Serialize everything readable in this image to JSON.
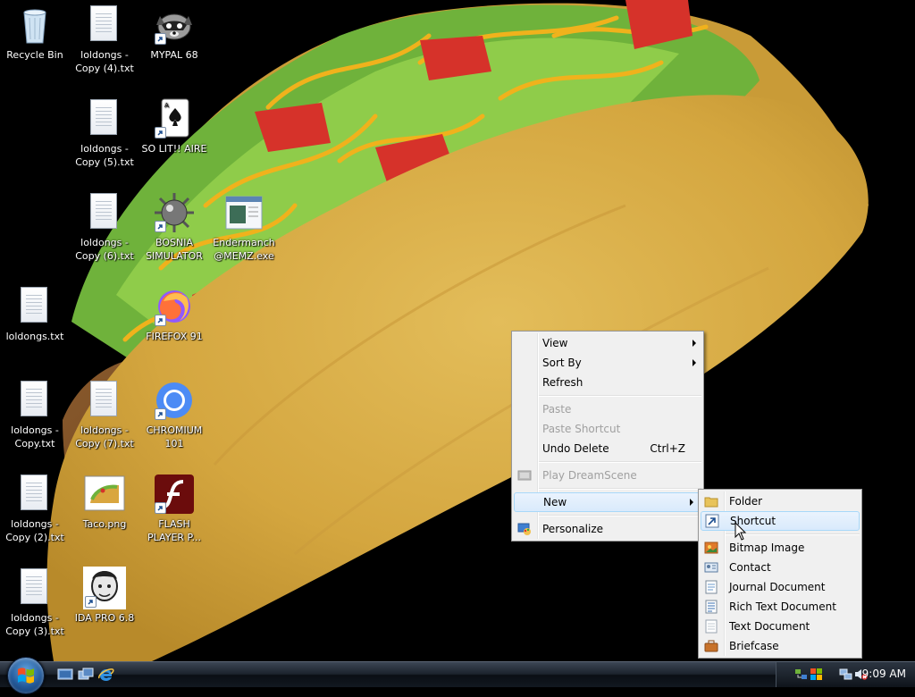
{
  "desktop": {
    "icons": [
      {
        "label": "Recycle Bin"
      },
      {
        "label": "loldongs - Copy (4).txt"
      },
      {
        "label": "MYPAL 68"
      },
      {
        "label": "loldongs - Copy (5).txt"
      },
      {
        "label": "SO LIT!! AIRE"
      },
      {
        "label": "loldongs - Copy (6).txt"
      },
      {
        "label": "BOSNIA SIMULATOR"
      },
      {
        "label": "Endermanch @MEMZ.exe"
      },
      {
        "label": "loldongs.txt"
      },
      {
        "label": "FIREFOX 91"
      },
      {
        "label": "loldongs - Copy.txt"
      },
      {
        "label": "loldongs - Copy (7).txt"
      },
      {
        "label": "CHROMIUM 101"
      },
      {
        "label": "loldongs - Copy (2).txt"
      },
      {
        "label": "Taco.png"
      },
      {
        "label": "FLASH PLAYER P..."
      },
      {
        "label": "loldongs - Copy (3).txt"
      },
      {
        "label": "IDA PRO 6.8"
      }
    ]
  },
  "context_menu": {
    "view": "View",
    "sort_by": "Sort By",
    "refresh": "Refresh",
    "paste": "Paste",
    "paste_shortcut": "Paste Shortcut",
    "undo_delete": "Undo Delete",
    "undo_delete_shortcut": "Ctrl+Z",
    "play_dreamscene": "Play DreamScene",
    "new": "New",
    "personalize": "Personalize"
  },
  "new_submenu": {
    "folder": "Folder",
    "shortcut": "Shortcut",
    "bitmap_image": "Bitmap Image",
    "contact": "Contact",
    "journal_document": "Journal Document",
    "rich_text_document": "Rich Text Document",
    "text_document": "Text Document",
    "briefcase": "Briefcase"
  },
  "taskbar": {
    "clock": "9:09 AM"
  },
  "colors": {
    "menu_bg": "#f0f0f0",
    "menu_highlight": "#d9eafc",
    "taskbar": "#1b222c",
    "desktop_bg": "#000000"
  }
}
